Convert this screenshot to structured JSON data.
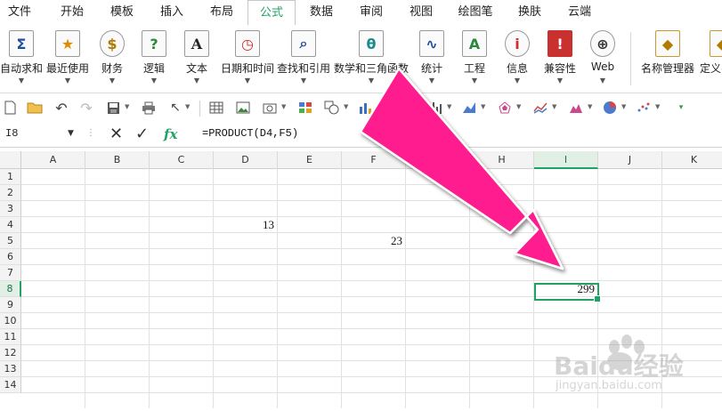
{
  "menu": {
    "tabs": [
      "文件",
      "开始",
      "模板",
      "插入",
      "布局",
      "公式",
      "数据",
      "审阅",
      "视图",
      "绘图笔",
      "换肤",
      "云端"
    ],
    "active_index": 5
  },
  "ribbon": {
    "buttons": [
      {
        "label": "自动求和",
        "glyph": "Σ"
      },
      {
        "label": "最近使用",
        "glyph": "★"
      },
      {
        "label": "财务",
        "glyph": "$"
      },
      {
        "label": "逻辑",
        "glyph": "?"
      },
      {
        "label": "文本",
        "glyph": "A"
      },
      {
        "label": "日期和时间",
        "glyph": "◷"
      },
      {
        "label": "查找和引用",
        "glyph": "⌕"
      },
      {
        "label": "数学和三角函数",
        "glyph": "θ"
      },
      {
        "label": "统计",
        "glyph": "∿"
      },
      {
        "label": "工程",
        "glyph": "A"
      },
      {
        "label": "信息",
        "glyph": "i"
      },
      {
        "label": "兼容性",
        "glyph": "!"
      },
      {
        "label": "Web",
        "glyph": "⊕"
      },
      {
        "label": "名称管理器",
        "glyph": "◆"
      },
      {
        "label": "定义名",
        "glyph": "◆"
      }
    ]
  },
  "formula_bar": {
    "name_box": "I8",
    "fx_label": "fx",
    "formula": "=PRODUCT(D4,F5)"
  },
  "grid": {
    "columns": [
      "A",
      "B",
      "C",
      "D",
      "E",
      "F",
      "G",
      "H",
      "I",
      "J",
      "K"
    ],
    "rows": [
      "1",
      "2",
      "3",
      "4",
      "5",
      "6",
      "7",
      "8",
      "9",
      "10",
      "11",
      "12",
      "13",
      "14"
    ],
    "selected_column": "I",
    "selected_row": "8",
    "cells": [
      {
        "ref": "D4",
        "value": "13"
      },
      {
        "ref": "F5",
        "value": "23"
      },
      {
        "ref": "I8",
        "value": "299"
      }
    ]
  },
  "colors": {
    "accent": "#21a366",
    "arrow": "#ff1f8e"
  },
  "watermark": {
    "brand": "Baidu经验",
    "url": "jingyan.baidu.com"
  }
}
